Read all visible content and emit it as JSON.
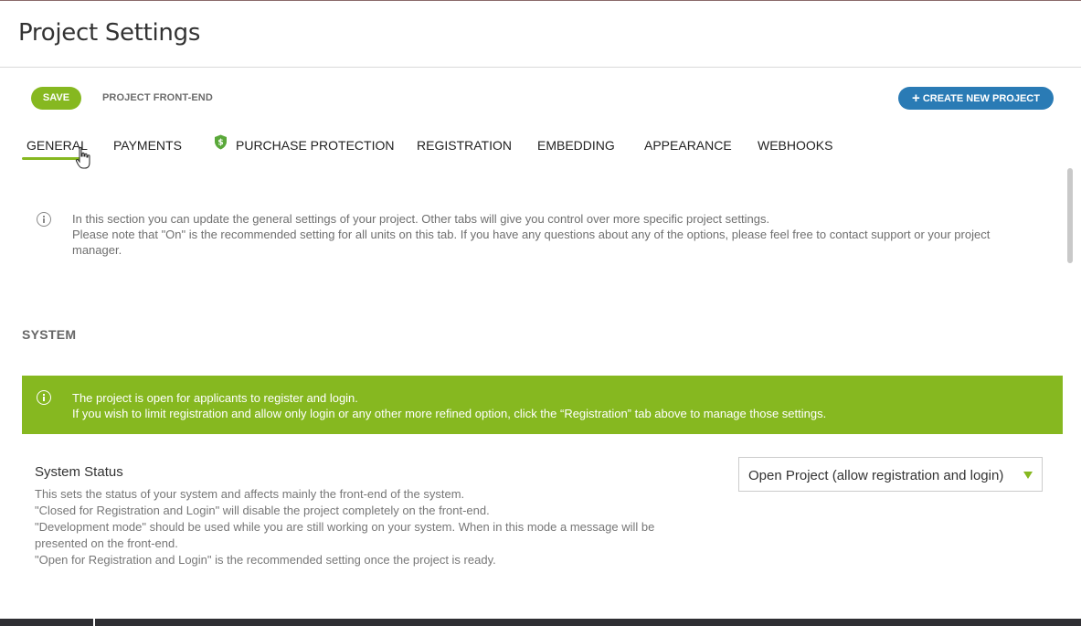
{
  "header": {
    "title": "Project Settings"
  },
  "toolbar": {
    "save_label": "SAVE",
    "frontend_label": "PROJECT FRONT-END",
    "create_label": "CREATE NEW PROJECT"
  },
  "tabs": [
    {
      "label": "GENERAL",
      "active": true
    },
    {
      "label": "PAYMENTS"
    },
    {
      "label": "PURCHASE PROTECTION",
      "icon": "shield-dollar-icon"
    },
    {
      "label": "REGISTRATION"
    },
    {
      "label": "EMBEDDING"
    },
    {
      "label": "APPEARANCE"
    },
    {
      "label": "WEBHOOKS"
    }
  ],
  "intro": {
    "line1": "In this section you can update the general settings of your project. Other tabs will give you control over more specific project settings.",
    "line2": "Please note that \"On\" is the recommended setting for all units on this tab. If you have any questions about any of the options, please feel free to contact support or your project manager."
  },
  "system": {
    "title": "SYSTEM",
    "banner_line1": "The project is open for applicants to register and login.",
    "banner_line2": "If you wish to limit registration and allow only login or any other more refined option, click the “Registration” tab above to manage those settings.",
    "status_label": "System Status",
    "status_desc": [
      "This sets the status of your system and affects mainly the front-end of the system.",
      "\"Closed for Registration and Login\" will disable the project completely on the front-end.",
      "\"Development mode\" should be used while you are still working on your system. When in this mode a message will be presented on the front-end.",
      "\"Open for Registration and Login\" is the recommended setting once the project is ready."
    ],
    "status_value": "Open Project (allow registration and login)"
  },
  "colors": {
    "accent": "#86b820",
    "primary": "#2a7bb5"
  }
}
